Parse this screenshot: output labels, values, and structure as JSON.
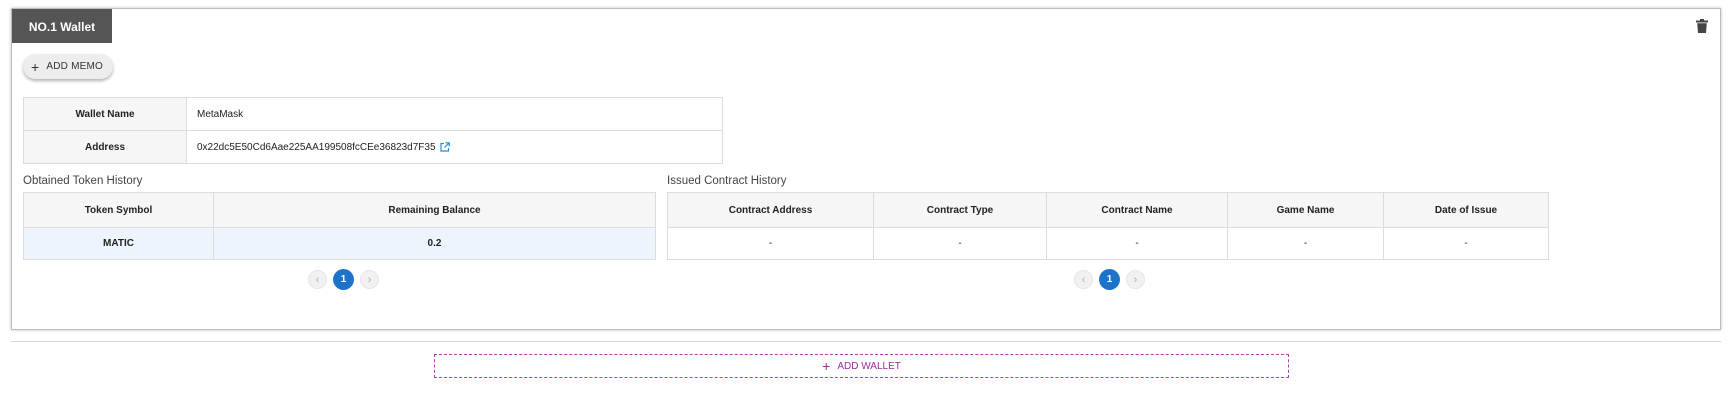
{
  "wallet": {
    "tab_label": "NO.1 Wallet",
    "add_memo_label": "ADD MEMO",
    "info": {
      "name_label": "Wallet Name",
      "name_value": "MetaMask",
      "address_label": "Address",
      "address_value": "0x22dc5E50Cd6Aae225AA199508fcCEe36823d7F35"
    }
  },
  "obtained_token_history": {
    "title": "Obtained Token History",
    "columns": [
      "Token Symbol",
      "Remaining Balance"
    ],
    "rows": [
      [
        "MATIC",
        "0.2"
      ]
    ],
    "pagination": {
      "current_page": "1"
    }
  },
  "issued_contract_history": {
    "title": "Issued Contract History",
    "columns": [
      "Contract Address",
      "Contract Type",
      "Contract Name",
      "Game Name",
      "Date of Issue"
    ],
    "rows": [
      [
        "-",
        "-",
        "-",
        "-",
        "-"
      ]
    ],
    "pagination": {
      "current_page": "1"
    }
  },
  "add_wallet_label": "ADD WALLET",
  "icons": {
    "trash": "trash-icon",
    "external_link": "external-link-icon",
    "plus": "plus-icon",
    "prev": "chevron-left-icon",
    "next": "chevron-right-icon"
  },
  "colors": {
    "tab_bg": "#555555",
    "page_active": "#1d73c9",
    "add_wallet": "#9b2d9b",
    "row_highlight": "#eef4fc",
    "link": "#2a8ad8"
  }
}
